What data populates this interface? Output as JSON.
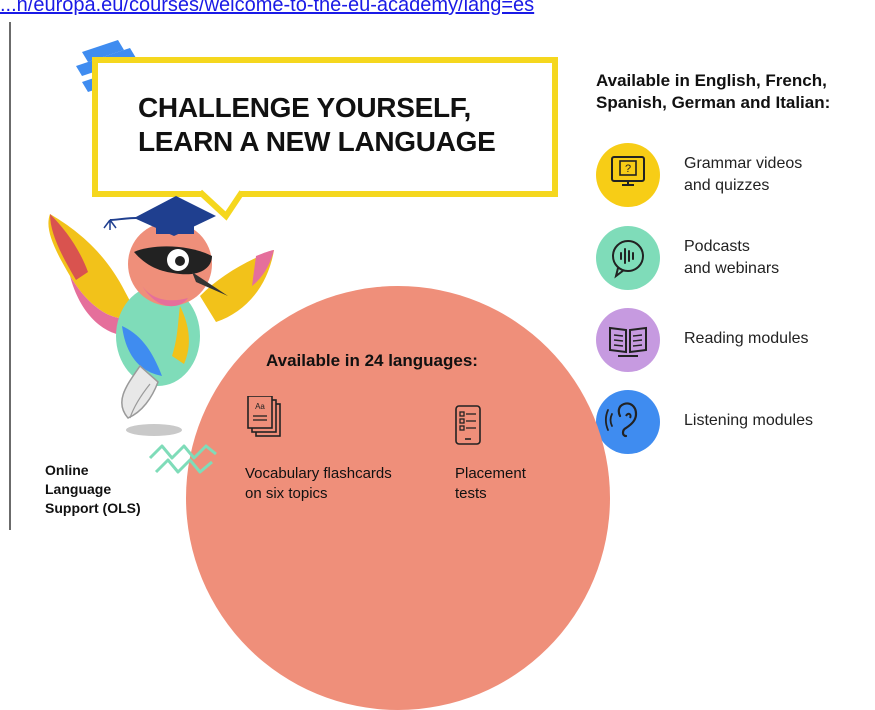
{
  "url": "...n/europa.eu/courses/welcome-to-the-eu-academy/lang=es",
  "headline": {
    "line1": "CHALLENGE YOURSELF,",
    "line2": "LEARN A NEW LANGUAGE"
  },
  "right_panel": {
    "heading_line1": "Available in English, French,",
    "heading_line2": "Spanish, German and Italian:",
    "features": [
      {
        "line1": "Grammar videos",
        "line2": "and quizzes",
        "icon": "monitor-question-icon",
        "color": "#f7cd16"
      },
      {
        "line1": "Podcasts",
        "line2": "and webinars",
        "icon": "podcast-sound-icon",
        "color": "#7fdcb9"
      },
      {
        "line1": "Reading modules",
        "line2": "",
        "icon": "book-icon",
        "color": "#c69ae0"
      },
      {
        "line1": "Listening modules",
        "line2": "",
        "icon": "ear-icon",
        "color": "#3f8cf0"
      }
    ]
  },
  "bottom_panel": {
    "heading": "Available in 24 languages:",
    "items": [
      {
        "line1": "Vocabulary flashcards",
        "line2": "on six topics",
        "icon": "flashcards-icon"
      },
      {
        "line1": "Placement",
        "line2": "tests",
        "icon": "tablet-test-icon"
      }
    ]
  },
  "ols": {
    "line1": "Online",
    "line2": "Language",
    "line3": "Support (OLS)"
  },
  "colors": {
    "yellow": "#f5d71e",
    "salmon": "#ef8f7a",
    "blue_stripes": "#3f8cf0",
    "zigzag": "#7fdcb9"
  }
}
